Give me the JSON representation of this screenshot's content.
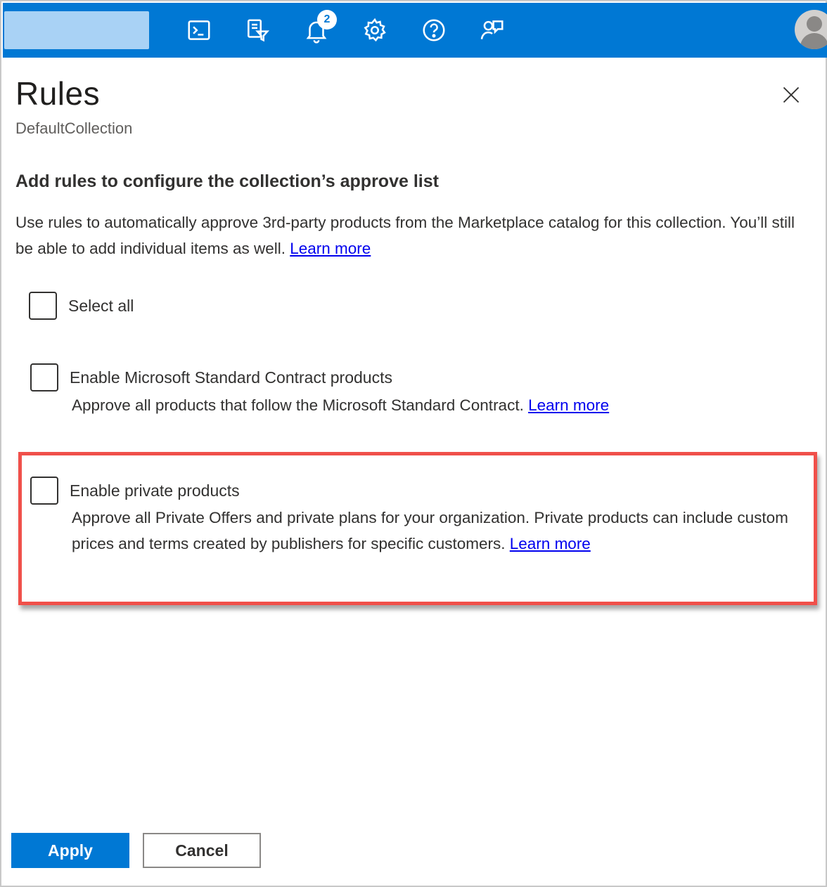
{
  "topbar": {
    "search_placeholder": "",
    "icons": [
      "cloud-shell-icon",
      "directory-filter-icon",
      "notifications-icon",
      "settings-icon",
      "help-icon",
      "feedback-icon"
    ],
    "notification_count": "2",
    "accent": "#0078d4"
  },
  "panel": {
    "title": "Rules",
    "subtitle": "DefaultCollection",
    "heading": "Add rules to configure the collection’s approve list",
    "description": "Use rules to automatically approve 3rd-party products from the Marketplace catalog for this collection. You’ll still be able to add individual items as well.",
    "description_link": "Learn more"
  },
  "rules": {
    "select_all": {
      "label": "Select all",
      "checked": false
    },
    "standard_contract": {
      "label": "Enable Microsoft Standard Contract products",
      "description": "Approve all products that follow the Microsoft Standard Contract.",
      "link": "Learn more",
      "checked": false
    },
    "private_products": {
      "label": "Enable private products",
      "description": "Approve all Private Offers and private plans for your organization. Private products can include custom prices and terms created by publishers for specific customers.",
      "link": "Learn more",
      "checked": false,
      "highlight_color": "#f0504a"
    }
  },
  "footer": {
    "apply_label": "Apply",
    "cancel_label": "Cancel"
  }
}
